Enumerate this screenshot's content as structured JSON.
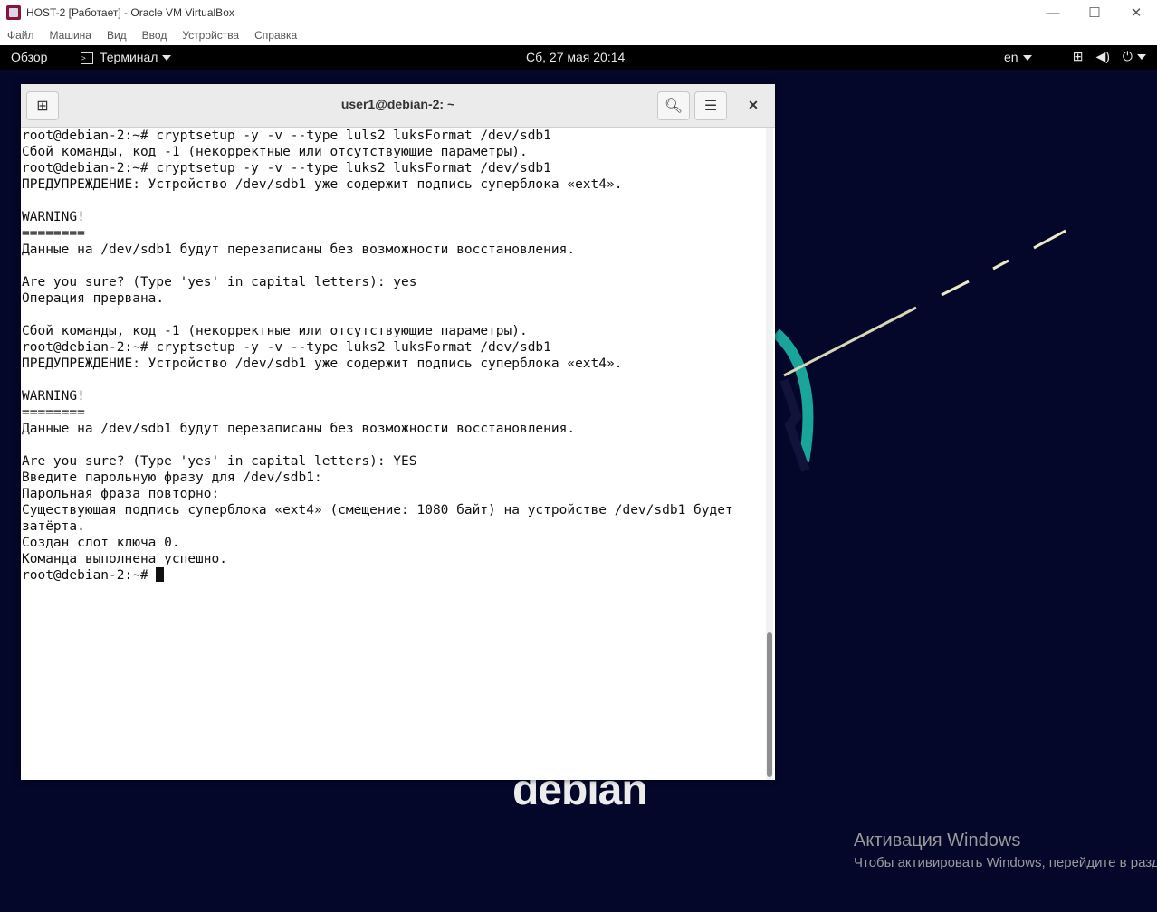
{
  "host": {
    "window_title": "HOST-2 [Работает] - Oracle VM VirtualBox",
    "menu": [
      "Файл",
      "Машина",
      "Вид",
      "Ввод",
      "Устройства",
      "Справка"
    ],
    "controls": {
      "minimize": "—",
      "maximize": "☐",
      "close": "✕"
    }
  },
  "gnome": {
    "activities": "Обзор",
    "app_menu": "Терминал",
    "clock": "Сб, 27 мая  20:14",
    "keyboard_layout": "en",
    "icons": [
      "network-icon",
      "volume-icon",
      "power-icon"
    ]
  },
  "terminal": {
    "title": "user1@debian-2: ~",
    "lines": [
      "root@debian-2:~# cryptsetup -y -v --type luls2 luksFormat /dev/sdb1",
      "Сбой команды, код -1 (некорректные или отсутствующие параметры).",
      "root@debian-2:~# cryptsetup -y -v --type luks2 luksFormat /dev/sdb1",
      "ПРЕДУПРЕЖДЕНИЕ: Устройство /dev/sdb1 уже содержит подпись суперблока «ext4».",
      "",
      "WARNING!",
      "========",
      "Данные на /dev/sdb1 будут перезаписаны без возможности восстановления.",
      "",
      "Are you sure? (Type 'yes' in capital letters): yes",
      "Операция прервана.",
      "",
      "Сбой команды, код -1 (некорректные или отсутствующие параметры).",
      "root@debian-2:~# cryptsetup -y -v --type luks2 luksFormat /dev/sdb1",
      "ПРЕДУПРЕЖДЕНИЕ: Устройство /dev/sdb1 уже содержит подпись суперблока «ext4».",
      "",
      "WARNING!",
      "========",
      "Данные на /dev/sdb1 будут перезаписаны без возможности восстановления.",
      "",
      "Are you sure? (Type 'yes' in capital letters): YES",
      "Введите парольную фразу для /dev/sdb1:",
      "Парольная фраза повторно:",
      "Существующая подпись суперблока «ext4» (смещение: 1080 байт) на устройстве /dev/sdb1 будет",
      "затёрта.",
      "Создан слот ключа 0.",
      "Команда выполнена успешно."
    ],
    "prompt": "root@debian-2:~# "
  },
  "desktop": {
    "logo_text": "debian",
    "activation_title": "Активация Windows",
    "activation_sub": "Чтобы активировать Windows, перейдите в раздел"
  }
}
